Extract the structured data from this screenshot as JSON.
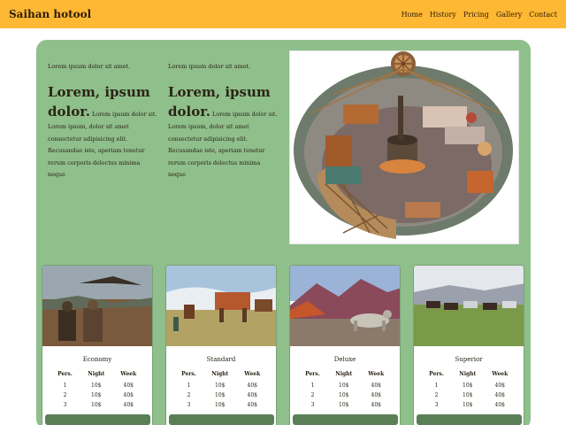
{
  "navbar": {
    "brand": "Saihan hotool",
    "links": [
      "Home",
      "History",
      "Pricing",
      "Gallery",
      "Contact"
    ]
  },
  "intro": {
    "columns": [
      {
        "small": "Lorem ipsum dolor sit amet.",
        "heading": "Lorem, ipsum",
        "lead": "dolor.",
        "body": "Lorem ipsum dolor sit. Lorem ipsum, dolor sit amet consectetur adipisicing elit. Recusandae iste, aperiam tenetur rerum corporis delectus minima neque"
      },
      {
        "small": "Lorem ipsum dolor sit amet.",
        "heading": "Lorem, ipsum",
        "lead": "dolor.",
        "body": "Lorem ipsum dolor sit. Lorem ipsum, dolor sit amet consectetur adipisicing elit. Recusandae iste, aperiam tenetur rerum corporis delectus minima neque"
      }
    ]
  },
  "table_headers": [
    "Pers.",
    "Night",
    "Week"
  ],
  "plans": [
    {
      "name": "Economy",
      "rows": [
        [
          "1",
          "10$",
          "40$"
        ],
        [
          "2",
          "10$",
          "40$"
        ],
        [
          "3",
          "10$",
          "40$"
        ]
      ]
    },
    {
      "name": "Standard",
      "rows": [
        [
          "1",
          "10$",
          "40$"
        ],
        [
          "2",
          "10$",
          "40$"
        ],
        [
          "3",
          "10$",
          "40$"
        ]
      ]
    },
    {
      "name": "Deluxe",
      "rows": [
        [
          "1",
          "10$",
          "40$"
        ],
        [
          "2",
          "10$",
          "40$"
        ],
        [
          "3",
          "10$",
          "40$"
        ]
      ]
    },
    {
      "name": "Superior",
      "rows": [
        [
          "1",
          "10$",
          "40$"
        ],
        [
          "2",
          "10$",
          "40$"
        ],
        [
          "3",
          "10$",
          "40$"
        ]
      ]
    }
  ],
  "colors": {
    "navbar": "#ffb833",
    "panel": "#8fbf8b",
    "button": "#5a7f57"
  }
}
